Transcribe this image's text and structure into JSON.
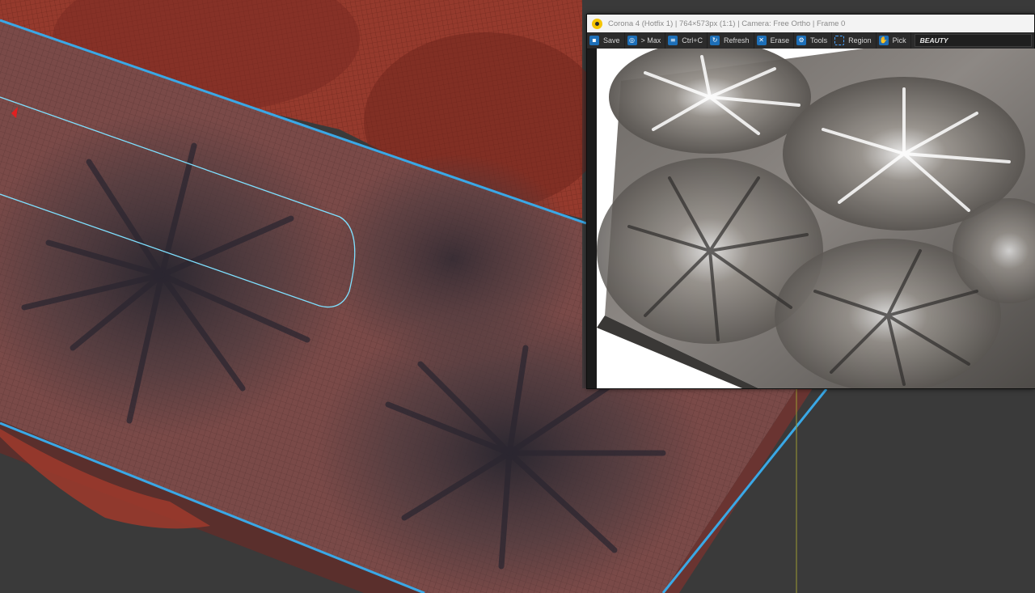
{
  "app": "3ds Max viewport with Corona Renderer",
  "viewport": {
    "mesh_color": "#8a3128",
    "highlight_color": "#3aa8e6",
    "background": "#3a3a3a"
  },
  "vfb": {
    "title": "Corona 4 (Hotfix 1) | 764×573px (1:1) | Camera: Free Ortho | Frame 0",
    "icon": "corona-logo-icon",
    "toolbar": {
      "save": "Save",
      "max": "> Max",
      "copy": "Ctrl+C",
      "refresh": "Refresh",
      "erase": "Erase",
      "tools": "Tools",
      "region": "Region",
      "pick": "Pick",
      "channel": "BEAUTY"
    },
    "accent": "#1d6fb8"
  }
}
